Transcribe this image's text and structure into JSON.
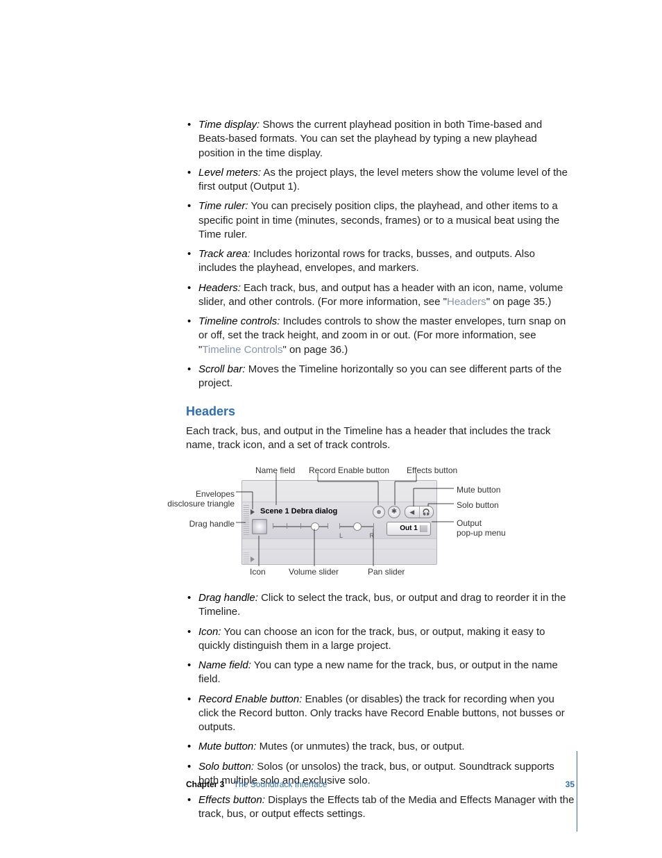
{
  "bullets_top": [
    {
      "term": "Time display:",
      "text": "Shows the current playhead position in both Time-based and Beats-based formats. You can set the playhead by typing a new playhead position in the time display."
    },
    {
      "term": "Level meters:",
      "text": "As the project plays, the level meters show the volume level of the first output (Output 1)."
    },
    {
      "term": "Time ruler:",
      "text": "You can precisely position clips, the playhead, and other items to a specific point in time (minutes, seconds, frames) or to a musical beat using the Time ruler."
    },
    {
      "term": "Track area:",
      "text": "Includes horizontal rows for tracks, busses, and outputs. Also includes the playhead, envelopes, and markers."
    },
    {
      "term": "Headers:",
      "text_before": "Each track, bus, and output has a header with an icon, name, volume slider, and other controls. (For more information, see \"",
      "link": "Headers",
      "text_after": "\" on page 35.)"
    },
    {
      "term": "Timeline controls:",
      "text_before": "Includes controls to show the master envelopes, turn snap on or off, set the track height, and zoom in or out. (For more information, see \"",
      "link": "Timeline Controls",
      "text_after": "\" on page 36.)"
    },
    {
      "term": "Scroll bar:",
      "text": "Moves the Timeline horizontally so you can see different parts of the project."
    }
  ],
  "section_heading": "Headers",
  "section_intro": "Each track, bus, and output in the Timeline has a header that includes the track name, track icon, and a set of track controls.",
  "callouts": {
    "name_field": "Name field",
    "record_enable": "Record Enable button",
    "effects": "Effects button",
    "envelopes": "Envelopes disclosure triangle",
    "drag_handle": "Drag handle",
    "icon": "Icon",
    "volume_slider": "Volume slider",
    "pan_slider": "Pan slider",
    "mute": "Mute button",
    "solo": "Solo button",
    "output_popup_l1": "Output",
    "output_popup_l2": "pop-up menu"
  },
  "track": {
    "name": "Scene 1 Debra dialog",
    "out_label": "Out 1",
    "pan_left": "L",
    "pan_right": "R"
  },
  "bullets_bottom": [
    {
      "term": "Drag handle:",
      "text": "Click to select the track, bus, or output and drag to reorder it in the Timeline."
    },
    {
      "term": "Icon:",
      "text": "You can choose an icon for the track, bus, or output, making it easy to quickly distinguish them in a large project."
    },
    {
      "term": "Name field:",
      "text": "You can type a new name for the track, bus, or output in the name field."
    },
    {
      "term": "Record Enable button:",
      "text": "Enables (or disables) the track for recording when you click the Record button. Only tracks have Record Enable buttons, not busses or outputs."
    },
    {
      "term": "Mute button:",
      "text": "Mutes (or unmutes) the track, bus, or output."
    },
    {
      "term": "Solo button:",
      "text": "Solos (or unsolos) the track, bus, or output. Soundtrack supports both multiple solo and exclusive solo."
    },
    {
      "term": "Effects button:",
      "text": "Displays the Effects tab of the Media and Effects Manager with the track, bus, or output effects settings."
    }
  ],
  "footer": {
    "chapter": "Chapter 3",
    "title": "The Soundtrack Interface",
    "page": "35"
  }
}
